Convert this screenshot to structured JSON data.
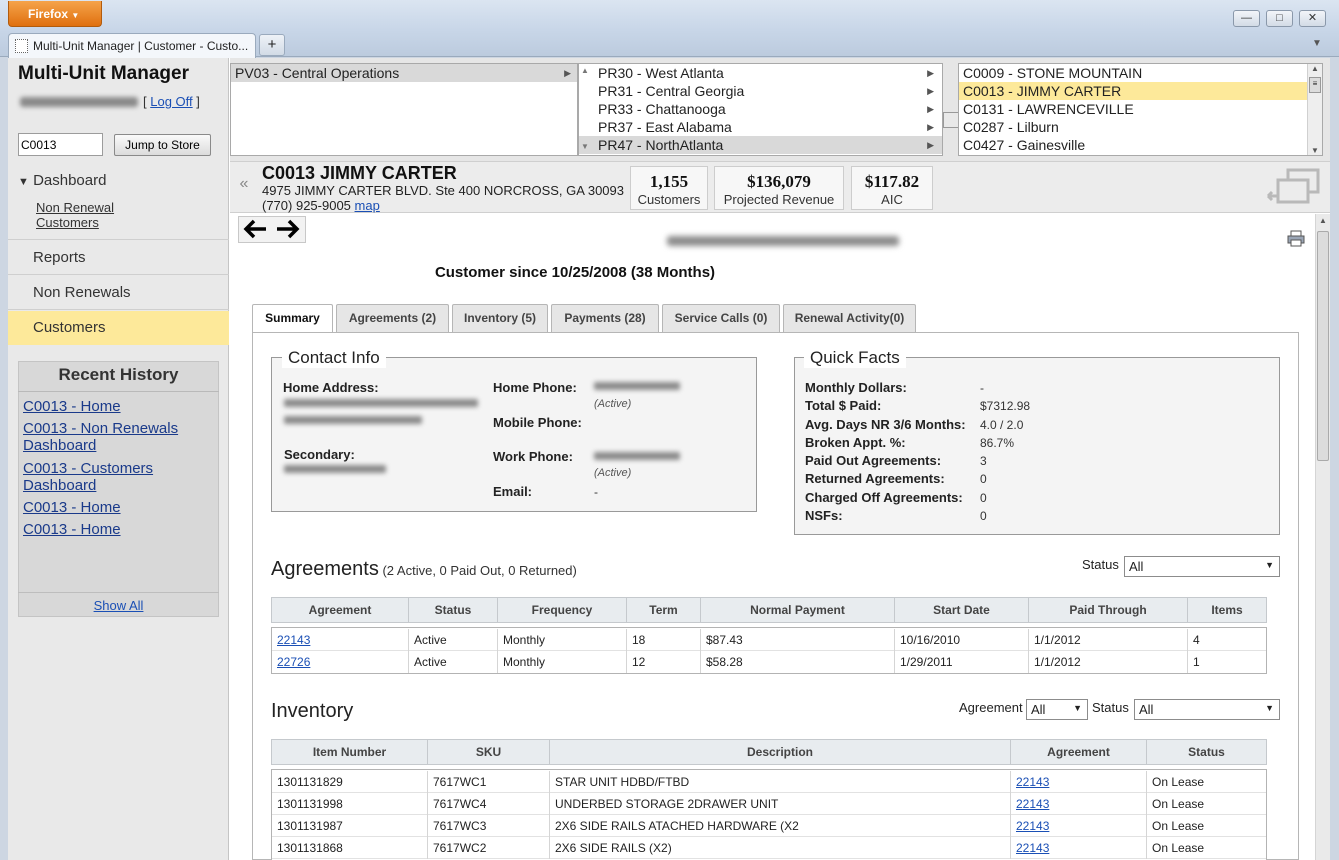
{
  "browser": {
    "menu_label": "Firefox",
    "tab_title": "Multi-Unit Manager | Customer - Custo...",
    "new_tab": "+",
    "win_min": "—",
    "win_max": "□",
    "win_close": "✕"
  },
  "sidebar": {
    "app_title": "Multi-Unit Manager",
    "logoff": "Log Off",
    "store_input_value": "C0013",
    "jump_button": "Jump to Store",
    "dashboard": "Dashboard",
    "dash_sub1": "Non Renewal",
    "dash_sub2": "Customers",
    "items": [
      {
        "label": "Reports"
      },
      {
        "label": "Non Renewals"
      },
      {
        "label": "Customers"
      }
    ],
    "history_title": "Recent History",
    "history": [
      {
        "label": "C0013 - Home"
      },
      {
        "label": "C0013 - Non Renewals Dashboard"
      },
      {
        "label": "C0013 - Customers Dashboard"
      },
      {
        "label": "C0013 - Home"
      },
      {
        "label": "C0013 - Home"
      }
    ],
    "show_all": "Show All"
  },
  "selectors": {
    "regions": [
      "PV03 - Central Operations"
    ],
    "districts": [
      "PR30 - West Atlanta",
      "PR31 - Central Georgia",
      "PR33 - Chattanooga",
      "PR37 - East Alabama",
      "PR47 - NorthAtlanta"
    ],
    "stores": [
      "C0009 - STONE MOUNTAIN",
      "C0013 - JIMMY CARTER",
      "C0131 - LAWRENCEVILLE",
      "C0287 - Lilburn",
      "C0427 - Gainesville"
    ]
  },
  "store_header": {
    "name": "C0013 JIMMY CARTER",
    "address": "4975 JIMMY CARTER BLVD. Ste 400 NORCROSS, GA 30093",
    "phone": "(770) 925-9005",
    "map_link": "map",
    "stats": [
      {
        "value": "1,155",
        "label": "Customers"
      },
      {
        "value": "$136,079",
        "label": "Projected Revenue"
      },
      {
        "value": "$117.82",
        "label": "AIC"
      }
    ]
  },
  "customer": {
    "since": "Customer since 10/25/2008 (38 Months)"
  },
  "tabs": [
    {
      "label": "Summary"
    },
    {
      "label": "Agreements (2)"
    },
    {
      "label": "Inventory (5)"
    },
    {
      "label": "Payments (28)"
    },
    {
      "label": "Service Calls (0)"
    },
    {
      "label": "Renewal Activity(0)"
    }
  ],
  "contact": {
    "legend": "Contact Info",
    "home_address_label": "Home Address:",
    "secondary_label": "Secondary:",
    "home_phone_label": "Home Phone:",
    "home_phone_note": "(Active)",
    "mobile_phone_label": "Mobile Phone:",
    "work_phone_label": "Work Phone:",
    "work_phone_note": "(Active)",
    "email_label": "Email:",
    "email_value": "-"
  },
  "quick_facts": {
    "legend": "Quick Facts",
    "rows": [
      {
        "label": "Monthly Dollars:",
        "value": "-"
      },
      {
        "label": "Total $ Paid:",
        "value": "$7312.98"
      },
      {
        "label": "Avg. Days NR 3/6 Months:",
        "value": "4.0 / 2.0"
      },
      {
        "label": "Broken Appt. %:",
        "value": "86.7%"
      },
      {
        "label": "Paid Out Agreements:",
        "value": "3"
      },
      {
        "label": "Returned Agreements:",
        "value": "0"
      },
      {
        "label": "Charged Off Agreements:",
        "value": "0"
      },
      {
        "label": "NSFs:",
        "value": "0"
      }
    ]
  },
  "agreements": {
    "title": "Agreements",
    "subtitle": "(2 Active, 0 Paid Out, 0 Returned)",
    "status_label": "Status",
    "status_value": "All",
    "columns": [
      "Agreement",
      "Status",
      "Frequency",
      "Term",
      "Normal Payment",
      "Start Date",
      "Paid Through",
      "Items"
    ],
    "rows": [
      [
        "22143",
        "Active",
        "Monthly",
        "18",
        "$87.43",
        "10/16/2010",
        "1/1/2012",
        "4"
      ],
      [
        "22726",
        "Active",
        "Monthly",
        "12",
        "$58.28",
        "1/29/2011",
        "1/1/2012",
        "1"
      ]
    ]
  },
  "inventory": {
    "title": "Inventory",
    "agreement_label": "Agreement",
    "agreement_value": "All",
    "status_label": "Status",
    "status_value": "All",
    "columns": [
      "Item Number",
      "SKU",
      "Description",
      "Agreement",
      "Status"
    ],
    "rows": [
      [
        "1301131829",
        "7617WC1",
        "STAR UNIT HDBD/FTBD",
        "22143",
        "On Lease"
      ],
      [
        "1301131998",
        "7617WC4",
        "UNDERBED STORAGE 2DRAWER UNIT",
        "22143",
        "On Lease"
      ],
      [
        "1301131987",
        "7617WC3",
        "2X6 SIDE RAILS ATACHED HARDWARE (X2",
        "22143",
        "On Lease"
      ],
      [
        "1301131868",
        "7617WC2",
        "2X6 SIDE RAILS (X2)",
        "22143",
        "On Lease"
      ]
    ]
  }
}
